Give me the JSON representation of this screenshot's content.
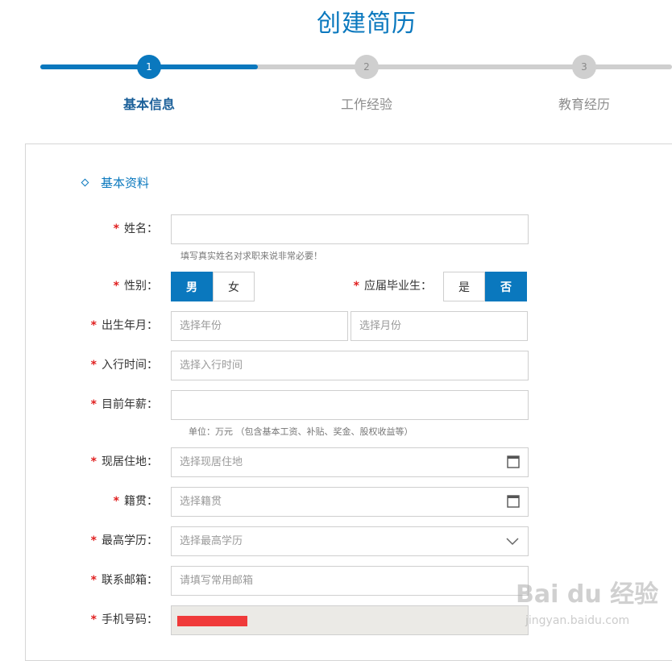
{
  "page": {
    "title": "创建简历"
  },
  "stepper": {
    "steps": [
      {
        "number": "1",
        "label": "基本信息",
        "state": "active"
      },
      {
        "number": "2",
        "label": "工作经验",
        "state": "inactive"
      },
      {
        "number": "3",
        "label": "教育经历",
        "state": "inactive"
      }
    ],
    "progress_fraction": 0.34
  },
  "section": {
    "title": "基本资料"
  },
  "form": {
    "required_mark": "*",
    "name": {
      "label": "姓名：",
      "value": "",
      "hint": "填写真实姓名对求职来说非常必要！"
    },
    "gender": {
      "label": "性别：",
      "options": [
        "男",
        "女"
      ],
      "selected": "男"
    },
    "fresh_grad": {
      "label": "应届毕业生：",
      "options": [
        "是",
        "否"
      ],
      "selected": "否"
    },
    "birth": {
      "label": "出生年月：",
      "year_placeholder": "选择年份",
      "month_placeholder": "选择月份"
    },
    "start_work": {
      "label": "入行时间：",
      "placeholder": "选择入行时间"
    },
    "salary": {
      "label": "目前年薪：",
      "value": "",
      "hint": "单位：万元 （包含基本工资、补贴、奖金、股权收益等）"
    },
    "residence": {
      "label": "现居住地：",
      "placeholder": "选择现居住地"
    },
    "hometown": {
      "label": "籍贯：",
      "placeholder": "选择籍贯"
    },
    "education": {
      "label": "最高学历：",
      "placeholder": "选择最高学历"
    },
    "email": {
      "label": "联系邮箱：",
      "placeholder": "请填写常用邮箱"
    },
    "phone": {
      "label": "手机号码：",
      "value": ""
    }
  },
  "watermark": {
    "logo": "Bai du 经验",
    "sub": "jingyan.baidu.com"
  },
  "colors": {
    "accent": "#0a78be",
    "required": "#e02020",
    "track": "#cfcfcf"
  }
}
